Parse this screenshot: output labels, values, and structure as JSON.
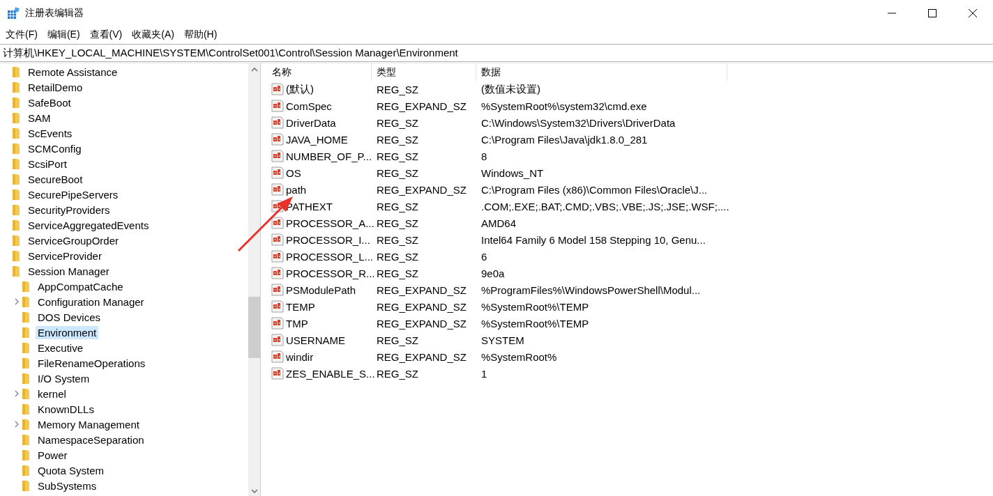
{
  "window": {
    "title": "注册表编辑器"
  },
  "menu": [
    "文件(F)",
    "编辑(E)",
    "查看(V)",
    "收藏夹(A)",
    "帮助(H)"
  ],
  "address": "计算机\\HKEY_LOCAL_MACHINE\\SYSTEM\\ControlSet001\\Control\\Session Manager\\Environment",
  "tree": [
    {
      "label": "Remote Assistance",
      "expandable": false,
      "selected": false
    },
    {
      "label": "RetailDemo",
      "expandable": false,
      "selected": false
    },
    {
      "label": "SafeBoot",
      "expandable": false,
      "selected": false
    },
    {
      "label": "SAM",
      "expandable": false,
      "selected": false
    },
    {
      "label": "ScEvents",
      "expandable": false,
      "selected": false
    },
    {
      "label": "SCMConfig",
      "expandable": false,
      "selected": false
    },
    {
      "label": "ScsiPort",
      "expandable": false,
      "selected": false
    },
    {
      "label": "SecureBoot",
      "expandable": false,
      "selected": false
    },
    {
      "label": "SecurePipeServers",
      "expandable": false,
      "selected": false
    },
    {
      "label": "SecurityProviders",
      "expandable": false,
      "selected": false
    },
    {
      "label": "ServiceAggregatedEvents",
      "expandable": false,
      "selected": false
    },
    {
      "label": "ServiceGroupOrder",
      "expandable": false,
      "selected": false
    },
    {
      "label": "ServiceProvider",
      "expandable": false,
      "selected": false
    },
    {
      "label": "Session Manager",
      "expandable": false,
      "selected": false,
      "children": [
        {
          "label": "AppCompatCache",
          "expandable": false,
          "selected": false
        },
        {
          "label": "Configuration Manager",
          "expandable": true,
          "selected": false
        },
        {
          "label": "DOS Devices",
          "expandable": false,
          "selected": false
        },
        {
          "label": "Environment",
          "expandable": false,
          "selected": true
        },
        {
          "label": "Executive",
          "expandable": false,
          "selected": false
        },
        {
          "label": "FileRenameOperations",
          "expandable": false,
          "selected": false
        },
        {
          "label": "I/O System",
          "expandable": false,
          "selected": false
        },
        {
          "label": "kernel",
          "expandable": true,
          "selected": false
        },
        {
          "label": "KnownDLLs",
          "expandable": false,
          "selected": false
        },
        {
          "label": "Memory Management",
          "expandable": true,
          "selected": false
        },
        {
          "label": "NamespaceSeparation",
          "expandable": false,
          "selected": false
        },
        {
          "label": "Power",
          "expandable": false,
          "selected": false
        },
        {
          "label": "Quota System",
          "expandable": false,
          "selected": false
        },
        {
          "label": "SubSystems",
          "expandable": false,
          "selected": false
        }
      ]
    }
  ],
  "table": {
    "columns": [
      "名称",
      "类型",
      "数据"
    ],
    "rows": [
      [
        "(默认)",
        "REG_SZ",
        "(数值未设置)"
      ],
      [
        "ComSpec",
        "REG_EXPAND_SZ",
        "%SystemRoot%\\system32\\cmd.exe"
      ],
      [
        "DriverData",
        "REG_SZ",
        "C:\\Windows\\System32\\Drivers\\DriverData"
      ],
      [
        "JAVA_HOME",
        "REG_SZ",
        "C:\\Program Files\\Java\\jdk1.8.0_281"
      ],
      [
        "NUMBER_OF_P...",
        "REG_SZ",
        "8"
      ],
      [
        "OS",
        "REG_SZ",
        "Windows_NT"
      ],
      [
        "path",
        "REG_EXPAND_SZ",
        "C:\\Program Files (x86)\\Common Files\\Oracle\\J..."
      ],
      [
        "PATHEXT",
        "REG_SZ",
        ".COM;.EXE;.BAT;.CMD;.VBS;.VBE;.JS;.JSE;.WSF;...."
      ],
      [
        "PROCESSOR_A...",
        "REG_SZ",
        "AMD64"
      ],
      [
        "PROCESSOR_I...",
        "REG_SZ",
        "Intel64 Family 6 Model 158 Stepping 10, Genu..."
      ],
      [
        "PROCESSOR_L...",
        "REG_SZ",
        "6"
      ],
      [
        "PROCESSOR_R...",
        "REG_SZ",
        "9e0a"
      ],
      [
        "PSModulePath",
        "REG_EXPAND_SZ",
        "%ProgramFiles%\\WindowsPowerShell\\Modul..."
      ],
      [
        "TEMP",
        "REG_EXPAND_SZ",
        "%SystemRoot%\\TEMP"
      ],
      [
        "TMP",
        "REG_EXPAND_SZ",
        "%SystemRoot%\\TEMP"
      ],
      [
        "USERNAME",
        "REG_SZ",
        "SYSTEM"
      ],
      [
        "windir",
        "REG_EXPAND_SZ",
        "%SystemRoot%"
      ],
      [
        "ZES_ENABLE_S...",
        "REG_SZ",
        "1"
      ]
    ]
  }
}
